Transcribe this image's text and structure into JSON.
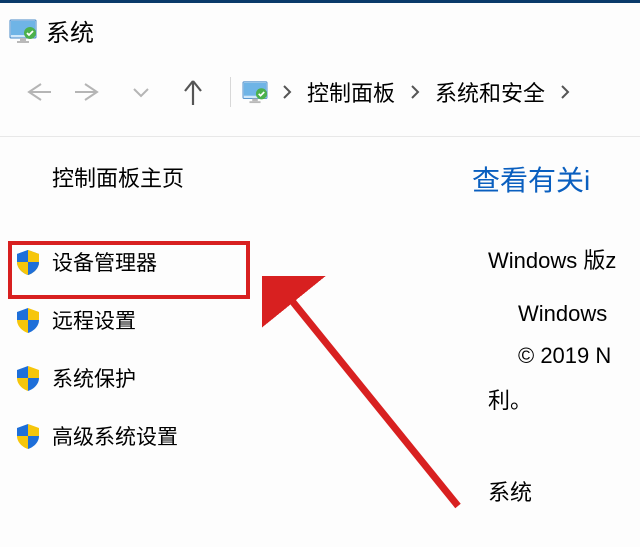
{
  "titlebar": {
    "title": "系统"
  },
  "breadcrumb": {
    "items": [
      "控制面板",
      "系统和安全"
    ]
  },
  "sidebar": {
    "title": "控制面板主页",
    "items": [
      {
        "label": "设备管理器"
      },
      {
        "label": "远程设置"
      },
      {
        "label": "系统保护"
      },
      {
        "label": "高级系统设置"
      }
    ]
  },
  "content": {
    "heading": "查看有关i",
    "edition_label": "Windows 版z",
    "edition_value": "Windows",
    "copyright_line1": "© 2019 N",
    "copyright_line2": "利。",
    "section2_label": "系统"
  }
}
